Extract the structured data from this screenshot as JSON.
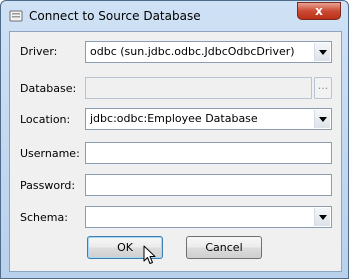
{
  "window": {
    "title": "Connect to Source Database",
    "close_symbol": "x"
  },
  "form": {
    "driver": {
      "label": "Driver:",
      "value": "odbc  (sun.jdbc.odbc.JdbcOdbcDriver)"
    },
    "database": {
      "label": "Database:",
      "value": "",
      "browse_label": "..."
    },
    "location": {
      "label": "Location:",
      "value": "jdbc:odbc:Employee Database"
    },
    "username": {
      "label": "Username:",
      "value": ""
    },
    "password": {
      "label": "Password:",
      "value": ""
    },
    "schema": {
      "label": "Schema:",
      "value": ""
    }
  },
  "buttons": {
    "ok": "OK",
    "cancel": "Cancel"
  },
  "icons": {
    "title": "database-icon",
    "close": "close-icon",
    "dropdown": "chevron-down-icon",
    "cursor": "mouse-pointer-icon"
  }
}
